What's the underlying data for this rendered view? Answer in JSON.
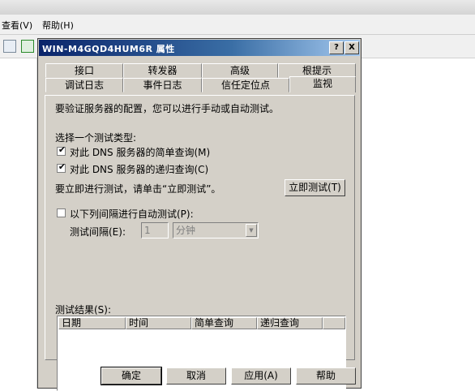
{
  "background_app": {
    "menu": [
      "查看(V)",
      "帮助(H)"
    ]
  },
  "dialog": {
    "title": "WIN-M4GQD4HUM6R 属性",
    "help_btn": "?",
    "close_btn": "X",
    "tabs_row1": [
      "接口",
      "转发器",
      "高级",
      "根提示"
    ],
    "tabs_row2": [
      "调试日志",
      "事件日志",
      "信任定位点",
      "监视"
    ],
    "active_tab": "监视",
    "monitor": {
      "intro": "要验证服务器的配置，您可以进行手动或自动测试。",
      "select_type_label": "选择一个测试类型:",
      "simple_query": {
        "label": "对此 DNS 服务器的简单查询(M)",
        "checked": true,
        "mark": "✔"
      },
      "recursive_query": {
        "label": "对此 DNS 服务器的递归查询(C)",
        "checked": true,
        "mark": "✔"
      },
      "test_now_text": "要立即进行测试，请单击“立即测试”。",
      "test_now_button": "立即测试(T)",
      "auto_test": {
        "label": "以下列间隔进行自动测试(P):",
        "checked": false
      },
      "interval_label": "测试间隔(E):",
      "interval_value": "1",
      "interval_unit": "分钟",
      "results_label": "测试结果(S):",
      "columns": [
        "日期",
        "时间",
        "简单查询",
        "递归查询"
      ]
    },
    "buttons": {
      "ok": "确定",
      "cancel": "取消",
      "apply": "应用(A)",
      "help": "帮助"
    }
  }
}
